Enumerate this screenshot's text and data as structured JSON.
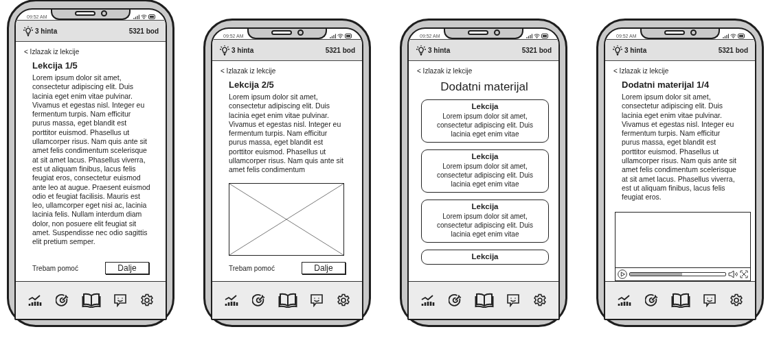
{
  "phones": [
    {
      "status_time": "09:52 AM",
      "hints": "3 hinta",
      "points": "5321 bod",
      "back": "< Izlazak iz lekcije",
      "content": {
        "kind": "lesson",
        "title": "Lekcija 1/5",
        "body": "Lorem ipsum dolor sit amet, consectetur adipiscing elit. Duis lacinia eget enim vitae pulvinar. Vivamus et egestas nisl. Integer eu fermentum turpis. Nam efficitur purus massa, eget blandit est porttitor euismod. Phasellus ut ullamcorper risus. Nam quis ante sit amet felis condimentum scelerisque at sit amet lacus. Phasellus viverra, est ut aliquam finibus, lacus felis feugiat eros, consectetur euismod ante leo at augue. Praesent euismod odio et feugiat facilisis. Mauris est leo, ullamcorper eget nisi ac, lacinia lacinia felis. Nullam interdum diam dolor, non posuere elit feugiat sit amet. Suspendisse nec odio sagittis elit pretium semper.",
        "help": "Trebam pomoć",
        "next": "Dalje"
      }
    },
    {
      "status_time": "09:52 AM",
      "hints": "3 hinta",
      "points": "5321 bod",
      "back": "< Izlazak iz lekcije",
      "content": {
        "kind": "lesson",
        "title": "Lekcija 2/5",
        "body": "Lorem ipsum dolor sit amet, consectetur adipiscing elit. Duis lacinia eget enim vitae pulvinar. Vivamus et egestas nisl. Integer eu fermentum turpis. Nam efficitur purus massa, eget blandit est porttitor euismod. Phasellus ut ullamcorper risus. Nam quis ante sit amet felis condimentum",
        "media": {
          "kind": "image"
        },
        "help": "Trebam pomoć",
        "next": "Dalje"
      }
    },
    {
      "status_time": "09:52 AM",
      "hints": "3 hinta",
      "points": "5321 bod",
      "back": "< Izlazak iz lekcije",
      "content": {
        "kind": "list",
        "heading": "Dodatni materijal",
        "cards": [
          {
            "title": "Lekcija",
            "text": "Lorem ipsum dolor sit amet, consectetur adipiscing elit. Duis lacinia eget enim vitae"
          },
          {
            "title": "Lekcija",
            "text": "Lorem ipsum dolor sit amet, consectetur adipiscing elit. Duis lacinia eget enim vitae"
          },
          {
            "title": "Lekcija",
            "text": "Lorem ipsum dolor sit amet, consectetur adipiscing elit. Duis lacinia eget enim vitae"
          },
          {
            "title": "Lekcija"
          }
        ]
      }
    },
    {
      "status_time": "09:52 AM",
      "hints": "3 hinta",
      "points": "5321 bod",
      "back": "< Izlazak iz lekcije",
      "content": {
        "kind": "lesson",
        "title": "Dodatni materijal 1/4",
        "body": "Lorem ipsum dolor sit amet, consectetur adipiscing elit. Duis lacinia eget enim vitae pulvinar. Vivamus et egestas nisl. Integer eu fermentum turpis. Nam efficitur purus massa, eget blandit est porttitor euismod. Phasellus ut ullamcorper risus. Nam quis ante sit amet felis condimentum scelerisque at sit amet lacus. Phasellus viverra, est ut aliquam finibus, lacus felis feugiat eros.",
        "media": {
          "kind": "video",
          "level": 0.55
        }
      }
    }
  ]
}
